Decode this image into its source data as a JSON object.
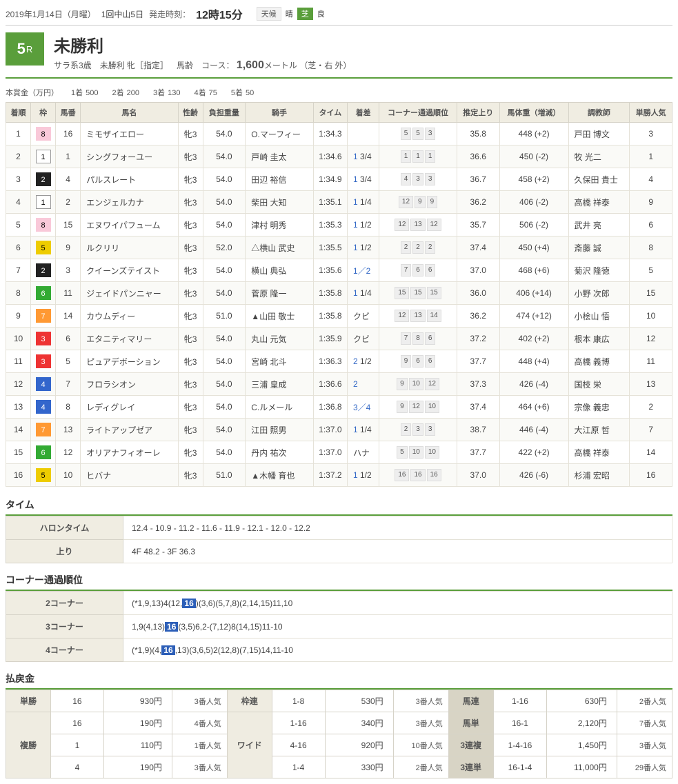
{
  "header": {
    "date": "2019年1月14日（月曜）",
    "meeting": "1回中山5日",
    "post_label": "発走時刻：",
    "post_time": "12時15分",
    "weather_label": "天候",
    "weather": "晴",
    "turf_badge": "芝",
    "condition": "良"
  },
  "race": {
    "number": "5",
    "suffix": "R",
    "name": "未勝利",
    "class": "サラ系3歳",
    "cond1": "未勝利 牝［指定］",
    "weight_type": "馬齢",
    "course_label": "コース：",
    "distance": "1,600",
    "dist_unit": "メートル",
    "course_note": "（芝・右 外）"
  },
  "prize": {
    "label": "本賞金（万円）",
    "items": [
      {
        "rank": "1着",
        "val": "500"
      },
      {
        "rank": "2着",
        "val": "200"
      },
      {
        "rank": "3着",
        "val": "130"
      },
      {
        "rank": "4着",
        "val": "75"
      },
      {
        "rank": "5着",
        "val": "50"
      }
    ]
  },
  "columns": [
    "着順",
    "枠",
    "馬番",
    "馬名",
    "性齢",
    "負担重量",
    "騎手",
    "タイム",
    "着差",
    "コーナー通過順位",
    "推定上り",
    "馬体重（増減）",
    "調教師",
    "単勝人気"
  ],
  "rows": [
    {
      "fin": "1",
      "waku": "8",
      "num": "16",
      "name": "ミモザイエロー",
      "sa": "牝3",
      "wt": "54.0",
      "jk": "O.マーフィー",
      "time": "1:34.3",
      "mg": "",
      "cn": [
        "5",
        "5",
        "3"
      ],
      "ag": "35.8",
      "bw": "448 (+2)",
      "tr": "戸田 博文",
      "pop": "3"
    },
    {
      "fin": "2",
      "waku": "1",
      "num": "1",
      "name": "シングフォーユー",
      "sa": "牝3",
      "wt": "54.0",
      "jk": "戸崎 圭太",
      "time": "1:34.6",
      "mg": "1 3/4",
      "cn": [
        "1",
        "1",
        "1"
      ],
      "ag": "36.6",
      "bw": "450 (-2)",
      "tr": "牧 光二",
      "pop": "1"
    },
    {
      "fin": "3",
      "waku": "2",
      "num": "4",
      "name": "パルスレート",
      "sa": "牝3",
      "wt": "54.0",
      "jk": "田辺 裕信",
      "time": "1:34.9",
      "mg": "1 3/4",
      "cn": [
        "4",
        "3",
        "3"
      ],
      "ag": "36.7",
      "bw": "458 (+2)",
      "tr": "久保田 貴士",
      "pop": "4"
    },
    {
      "fin": "4",
      "waku": "1",
      "num": "2",
      "name": "エンジェルカナ",
      "sa": "牝3",
      "wt": "54.0",
      "jk": "柴田 大知",
      "time": "1:35.1",
      "mg": "1 1/4",
      "cn": [
        "12",
        "9",
        "9"
      ],
      "ag": "36.2",
      "bw": "406 (-2)",
      "tr": "高橋 祥泰",
      "pop": "9"
    },
    {
      "fin": "5",
      "waku": "8",
      "num": "15",
      "name": "エヌワイパフューム",
      "sa": "牝3",
      "wt": "54.0",
      "jk": "津村 明秀",
      "time": "1:35.3",
      "mg": "1 1/2",
      "cn": [
        "12",
        "13",
        "12"
      ],
      "ag": "35.7",
      "bw": "506 (-2)",
      "tr": "武井 亮",
      "pop": "6"
    },
    {
      "fin": "6",
      "waku": "5",
      "num": "9",
      "name": "ルクリリ",
      "sa": "牝3",
      "wt": "52.0",
      "jk": "△横山 武史",
      "time": "1:35.5",
      "mg": "1 1/2",
      "cn": [
        "2",
        "2",
        "2"
      ],
      "ag": "37.4",
      "bw": "450 (+4)",
      "tr": "斎藤 誠",
      "pop": "8"
    },
    {
      "fin": "7",
      "waku": "2",
      "num": "3",
      "name": "クイーンズテイスト",
      "sa": "牝3",
      "wt": "54.0",
      "jk": "横山 典弘",
      "time": "1:35.6",
      "mg": "1／2",
      "cn": [
        "7",
        "6",
        "6"
      ],
      "ag": "37.0",
      "bw": "468 (+6)",
      "tr": "菊沢 隆徳",
      "pop": "5"
    },
    {
      "fin": "8",
      "waku": "6",
      "num": "11",
      "name": "ジェイドパンニャー",
      "sa": "牝3",
      "wt": "54.0",
      "jk": "菅原 隆一",
      "time": "1:35.8",
      "mg": "1 1/4",
      "cn": [
        "15",
        "15",
        "15"
      ],
      "ag": "36.0",
      "bw": "406 (+14)",
      "tr": "小野 次郎",
      "pop": "15"
    },
    {
      "fin": "9",
      "waku": "7",
      "num": "14",
      "name": "カウムディー",
      "sa": "牝3",
      "wt": "51.0",
      "jk": "▲山田 敬士",
      "time": "1:35.8",
      "mg": "クビ",
      "cn": [
        "12",
        "13",
        "14"
      ],
      "ag": "36.2",
      "bw": "474 (+12)",
      "tr": "小桧山 悟",
      "pop": "10"
    },
    {
      "fin": "10",
      "waku": "3",
      "num": "6",
      "name": "エタニティマリー",
      "sa": "牝3",
      "wt": "54.0",
      "jk": "丸山 元気",
      "time": "1:35.9",
      "mg": "クビ",
      "cn": [
        "7",
        "8",
        "6"
      ],
      "ag": "37.2",
      "bw": "402 (+2)",
      "tr": "根本 康広",
      "pop": "12"
    },
    {
      "fin": "11",
      "waku": "3",
      "num": "5",
      "name": "ピュアデボーション",
      "sa": "牝3",
      "wt": "54.0",
      "jk": "宮崎 北斗",
      "time": "1:36.3",
      "mg": "2 1/2",
      "cn": [
        "9",
        "6",
        "6"
      ],
      "ag": "37.7",
      "bw": "448 (+4)",
      "tr": "高橋 義博",
      "pop": "11"
    },
    {
      "fin": "12",
      "waku": "4",
      "num": "7",
      "name": "フロラシオン",
      "sa": "牝3",
      "wt": "54.0",
      "jk": "三浦 皇成",
      "time": "1:36.6",
      "mg": "2",
      "cn": [
        "9",
        "10",
        "12"
      ],
      "ag": "37.3",
      "bw": "426 (-4)",
      "tr": "国枝 栄",
      "pop": "13"
    },
    {
      "fin": "13",
      "waku": "4",
      "num": "8",
      "name": "レディグレイ",
      "sa": "牝3",
      "wt": "54.0",
      "jk": "C.ルメール",
      "time": "1:36.8",
      "mg": "3／4",
      "cn": [
        "9",
        "12",
        "10"
      ],
      "ag": "37.4",
      "bw": "464 (+6)",
      "tr": "宗像 義忠",
      "pop": "2"
    },
    {
      "fin": "14",
      "waku": "7",
      "num": "13",
      "name": "ライトアップゼア",
      "sa": "牝3",
      "wt": "54.0",
      "jk": "江田 照男",
      "time": "1:37.0",
      "mg": "1 1/4",
      "cn": [
        "2",
        "3",
        "3"
      ],
      "ag": "38.7",
      "bw": "446 (-4)",
      "tr": "大江原 哲",
      "pop": "7"
    },
    {
      "fin": "15",
      "waku": "6",
      "num": "12",
      "name": "オリアナフィオーレ",
      "sa": "牝3",
      "wt": "54.0",
      "jk": "丹内 祐次",
      "time": "1:37.0",
      "mg": "ハナ",
      "cn": [
        "5",
        "10",
        "10"
      ],
      "ag": "37.7",
      "bw": "422 (+2)",
      "tr": "高橋 祥泰",
      "pop": "14"
    },
    {
      "fin": "16",
      "waku": "5",
      "num": "10",
      "name": "ヒバナ",
      "sa": "牝3",
      "wt": "51.0",
      "jk": "▲木幡 育也",
      "time": "1:37.2",
      "mg": "1 1/2",
      "cn": [
        "16",
        "16",
        "16"
      ],
      "ag": "37.0",
      "bw": "426 (-6)",
      "tr": "杉浦 宏昭",
      "pop": "16"
    }
  ],
  "time_section": {
    "title": "タイム",
    "furlong_label": "ハロンタイム",
    "furlong": "12.4 - 10.9 - 11.2 - 11.6 - 11.9 - 12.1 - 12.0 - 12.2",
    "agari_label": "上り",
    "agari": "4F 48.2 - 3F 36.3"
  },
  "corner_section": {
    "title": "コーナー通過順位",
    "rows": [
      {
        "label": "2コーナー",
        "pre": "(*1,9,13)4(12,",
        "hl": "16",
        "post": ")(3,6)(5,7,8)(2,14,15)11,10"
      },
      {
        "label": "3コーナー",
        "pre": "1,9(4,13)",
        "hl": "16",
        "post": "(3,5)6,2-(7,12)8(14,15)11-10"
      },
      {
        "label": "4コーナー",
        "pre": "(*1,9)(4,",
        "hl": "16",
        "post": ",13)(3,6,5)2(12,8)(7,15)14,11-10"
      }
    ]
  },
  "payout": {
    "title": "払戻金",
    "tansho": {
      "label": "単勝",
      "num": "16",
      "amt": "930円",
      "pop": "3番人気"
    },
    "fukusho": {
      "label": "複勝",
      "rows": [
        {
          "num": "16",
          "amt": "190円",
          "pop": "4番人気"
        },
        {
          "num": "1",
          "amt": "110円",
          "pop": "1番人気"
        },
        {
          "num": "4",
          "amt": "190円",
          "pop": "3番人気"
        }
      ]
    },
    "wakuren": {
      "label": "枠連",
      "combo": "1-8",
      "amt": "530円",
      "pop": "3番人気"
    },
    "wide": {
      "label": "ワイド",
      "rows": [
        {
          "combo": "1-16",
          "amt": "340円",
          "pop": "3番人気"
        },
        {
          "combo": "4-16",
          "amt": "920円",
          "pop": "10番人気"
        },
        {
          "combo": "1-4",
          "amt": "330円",
          "pop": "2番人気"
        }
      ]
    },
    "umaren": {
      "label": "馬連",
      "combo": "1-16",
      "amt": "630円",
      "pop": "2番人気"
    },
    "umatan": {
      "label": "馬単",
      "combo": "16-1",
      "amt": "2,120円",
      "pop": "7番人気"
    },
    "sanrenpuku": {
      "label": "3連複",
      "combo": "1-4-16",
      "amt": "1,450円",
      "pop": "3番人気"
    },
    "sanrentan": {
      "label": "3連単",
      "combo": "16-1-4",
      "amt": "11,000円",
      "pop": "29番人気"
    }
  }
}
